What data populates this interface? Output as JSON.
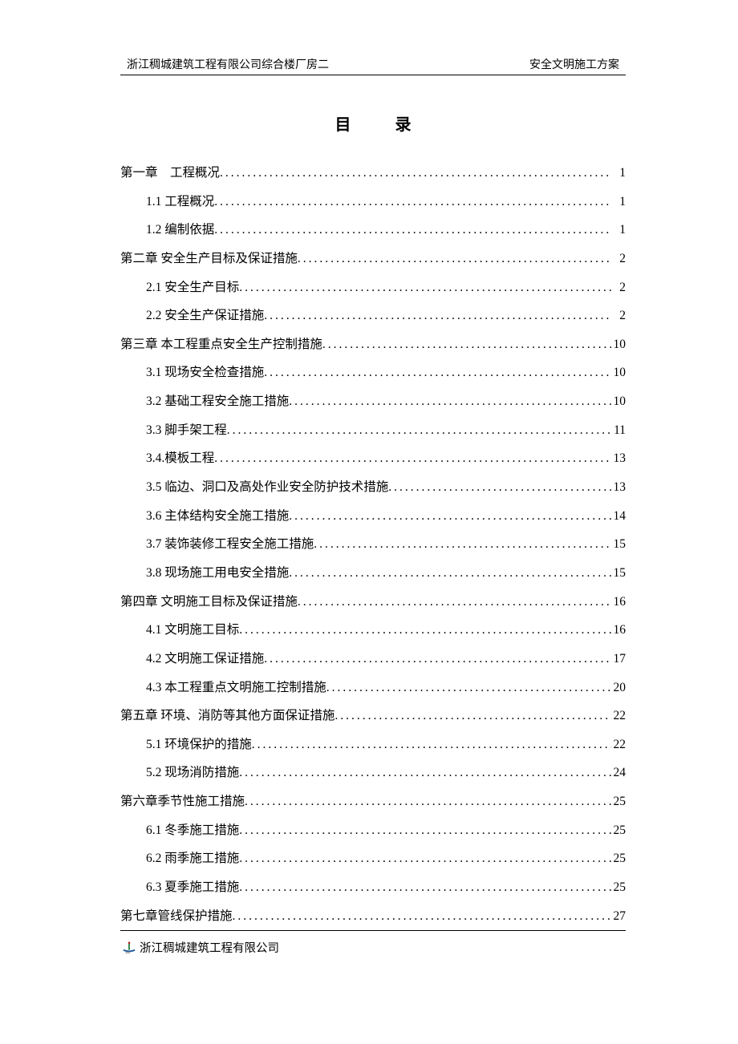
{
  "header": {
    "left": "浙江稠城建筑工程有限公司综合楼厂房二",
    "right": "安全文明施工方案"
  },
  "title": "目录",
  "toc": [
    {
      "level": 0,
      "text": "第一章　工程概况",
      "page": "1"
    },
    {
      "level": 1,
      "text": "1.1 工程概况",
      "page": "1"
    },
    {
      "level": 1,
      "text": "1.2 编制依据 ",
      "page": "1"
    },
    {
      "level": 0,
      "text": "第二章 安全生产目标及保证措施",
      "page": "2"
    },
    {
      "level": 1,
      "text": "2.1 安全生产目标 ",
      "page": "2"
    },
    {
      "level": 1,
      "text": "2.2 安全生产保证措施 ",
      "page": "2"
    },
    {
      "level": 0,
      "text": "第三章 本工程重点安全生产控制措施",
      "page": "10"
    },
    {
      "level": 1,
      "text": "3.1 现场安全检查措施 ",
      "page": "10"
    },
    {
      "level": 1,
      "text": "3.2 基础工程安全施工措施 ",
      "page": "10"
    },
    {
      "level": 1,
      "text": "3.3 脚手架工程 ",
      "page": "11"
    },
    {
      "level": 1,
      "text": "3.4.模板工程 ",
      "page": "13"
    },
    {
      "level": 1,
      "text": "3.5 临边、洞口及高处作业安全防护技术措施",
      "page": "13"
    },
    {
      "level": 1,
      "text": "3.6 主体结构安全施工措施",
      "page": "14"
    },
    {
      "level": 1,
      "text": "3.7 装饰装修工程安全施工措施 ",
      "page": "15"
    },
    {
      "level": 1,
      "text": "3.8 现场施工用电安全措施",
      "page": "15"
    },
    {
      "level": 0,
      "text": "第四章 文明施工目标及保证措施",
      "page": "16"
    },
    {
      "level": 1,
      "text": "4.1 文明施工目标 ",
      "page": "16"
    },
    {
      "level": 1,
      "text": "4.2 文明施工保证措施 ",
      "page": "17"
    },
    {
      "level": 1,
      "text": "4.3 本工程重点文明施工控制措施 ",
      "page": "20"
    },
    {
      "level": 0,
      "text": "第五章 环境、消防等其他方面保证措施",
      "page": "22"
    },
    {
      "level": 1,
      "text": "5.1 环境保护的措施 ",
      "page": "22"
    },
    {
      "level": 1,
      "text": "5.2 现场消防措施 ",
      "page": "24"
    },
    {
      "level": 0,
      "text": "第六章季节性施工措施",
      "page": "25"
    },
    {
      "level": 1,
      "text": "6.1 冬季施工措施 ",
      "page": "25"
    },
    {
      "level": 1,
      "text": "6.2 雨季施工措施 ",
      "page": "25"
    },
    {
      "level": 1,
      "text": "6.3 夏季施工措施 ",
      "page": "25"
    },
    {
      "level": 0,
      "text": "第七章管线保护措施",
      "page": "27"
    }
  ],
  "footer": {
    "company": "浙江稠城建筑工程有限公司"
  }
}
